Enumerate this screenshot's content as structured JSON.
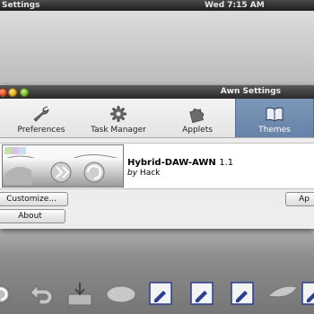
{
  "topbar": {
    "title": "Settings",
    "clock": "Wed  7:15 AM"
  },
  "awn_window": {
    "title": "Awn Settings"
  },
  "toolbar": {
    "items": [
      {
        "label": "Preferences",
        "icon": "wrench-icon",
        "active": false
      },
      {
        "label": "Task Manager",
        "icon": "gear-icon",
        "active": false
      },
      {
        "label": "Applets",
        "icon": "puzzle-icon",
        "active": false
      },
      {
        "label": "Themes",
        "icon": "book-icon",
        "active": true
      }
    ],
    "active_color": "#6f89ad"
  },
  "theme": {
    "name": "Hybrid-DAW-AWN",
    "version": "1.1",
    "by": "by",
    "author": "Hack"
  },
  "buttons": {
    "customize": "Customize...",
    "apply": "Ap",
    "about": "About"
  },
  "dock": {
    "icons": [
      "refresh-icon",
      "undo-icon",
      "install-icon",
      "mouse-icon",
      "edit-icon",
      "edit-icon",
      "edit-icon",
      "leaf-icon",
      "edit-icon"
    ]
  }
}
